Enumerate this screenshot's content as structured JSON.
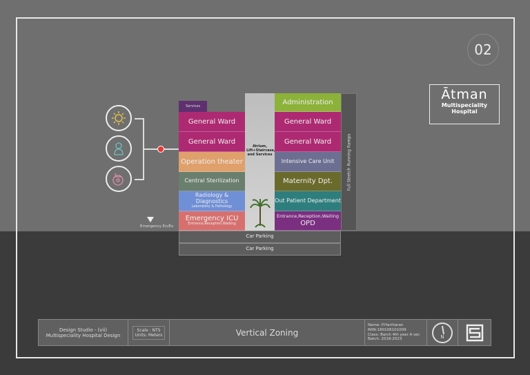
{
  "page_number": "02",
  "logo": {
    "name": "Ātman",
    "line1": "Multispeciality",
    "line2": "Hospital"
  },
  "icons": [
    "sun-icon",
    "elderly-person-icon",
    "wheelchair-icon"
  ],
  "left_column": {
    "services_tab": "Services",
    "blocks": [
      {
        "label": "General Ward",
        "color": "#ad2a72"
      },
      {
        "label": "General Ward",
        "color": "#ad2a72"
      },
      {
        "label": "Operation theater",
        "color": "#dfa06c"
      },
      {
        "label": "Central Sterilization",
        "color": "#6a7f6e"
      },
      {
        "label": "Radiology & Diagnostics",
        "sub": "Laboratory & Pathology",
        "color": "#6f8fd6"
      },
      {
        "label": "Emergency ICU",
        "sub": "Entrance,Reception,Waiting",
        "color": "#d6706f"
      }
    ]
  },
  "atrium": "Atrium, Lift+Staircase, and Services",
  "right_column": {
    "blocks": [
      {
        "label": "Administration",
        "color": "#8cb23a"
      },
      {
        "label": "General Ward",
        "color": "#ad2a72"
      },
      {
        "label": "General Ward",
        "color": "#ad2a72"
      },
      {
        "label": "Intensive Care Unit",
        "color": "#6d6f92"
      },
      {
        "label": "Maternity Dpt.",
        "color": "#6a6a2c"
      },
      {
        "label": "Out Patient Department",
        "color": "#2f7e7e"
      },
      {
        "label": "OPD",
        "sub": "Entrance,Reception,Waiting",
        "color": "#7b2f80"
      }
    ]
  },
  "ramps": "Full Stretch Running Ramps",
  "parking": [
    "Car Parking",
    "Car Parking"
  ],
  "emergency_label": "Emergency En/Ex",
  "title_block": {
    "studio": "Design Studio - (vii)",
    "project": "Multispeciality Hospital Design",
    "scale": "Scale : NTS",
    "units": "Units: Meters",
    "title": "Vertical Zoning",
    "name": "Name: P.Hariharan",
    "rrn": "RRN:180106101009",
    "class": "Class: Barch 4th year A sec",
    "batch": "Batch: 2018-2023",
    "north": "N"
  }
}
